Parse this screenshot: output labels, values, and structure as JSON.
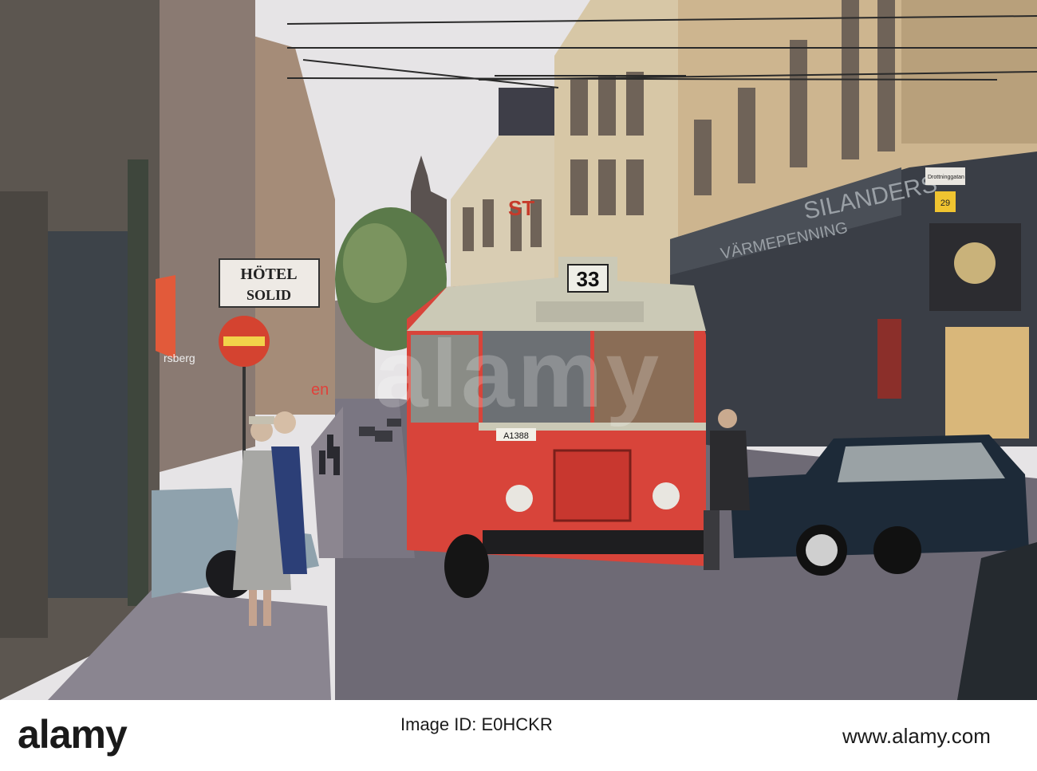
{
  "photo": {
    "signs": {
      "hotel_line1": "HÖTEL",
      "hotel_line2": "SOLID",
      "bus_route": "33",
      "bus_plate": "A1388",
      "letters_st": "ST",
      "shop_fascia": "SILANDERS",
      "shop_fascia2": "VÄRMEPENNING",
      "shop_partial": "rsberg",
      "street_sign": "Drottninggatan",
      "street_number": "29",
      "neon_partial": "en"
    },
    "colors": {
      "sky": "#e6e4e6",
      "bus_red": "#d8443a",
      "bus_cream": "#cbc9b6",
      "car_dark": "#1d2a38",
      "car_blue": "#8fa2ad",
      "road": "#6e6a75"
    }
  },
  "watermark": {
    "text": "alamy"
  },
  "footer": {
    "logo": "alamy",
    "image_id": "Image ID: E0HCKR",
    "url": "www.alamy.com"
  }
}
